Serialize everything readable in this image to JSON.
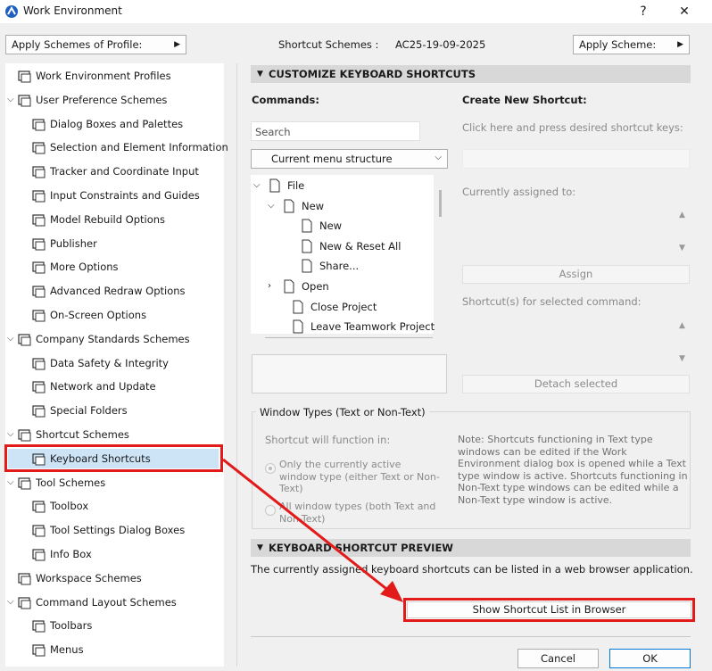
{
  "window": {
    "title": "Work Environment",
    "help_label": "?",
    "close_label": "✕"
  },
  "toolbar": {
    "apply_profile_label": "Apply Schemes of Profile:",
    "shortcut_schemes_label": "Shortcut Schemes :",
    "shortcut_schemes_value": "AC25-19-09-2025",
    "apply_scheme_label": "Apply Scheme:"
  },
  "sidebar": {
    "items": [
      {
        "label": "Work Environment Profiles",
        "icon": "profiles-icon"
      },
      {
        "label": "User Preference Schemes",
        "icon": "user-scheme-icon"
      },
      {
        "label": "Dialog Boxes and Palettes",
        "icon": "dialog-icon"
      },
      {
        "label": "Selection and Element Information",
        "icon": "selection-icon"
      },
      {
        "label": "Tracker and Coordinate Input",
        "icon": "xyz-icon"
      },
      {
        "label": "Input Constraints and Guides",
        "icon": "cursor-icon"
      },
      {
        "label": "Model Rebuild Options",
        "icon": "rebuild-icon"
      },
      {
        "label": "Publisher",
        "icon": "publisher-icon"
      },
      {
        "label": "More Options",
        "icon": "sliders-icon"
      },
      {
        "label": "Advanced Redraw Options",
        "icon": "redraw-icon"
      },
      {
        "label": "On-Screen Options",
        "icon": "screen-icon"
      },
      {
        "label": "Company Standards Schemes",
        "icon": "company-icon"
      },
      {
        "label": "Data Safety & Integrity",
        "icon": "safety-icon"
      },
      {
        "label": "Network and Update",
        "icon": "globe-icon"
      },
      {
        "label": "Special Folders",
        "icon": "folder-icon"
      },
      {
        "label": "Shortcut Schemes",
        "icon": "shortcut-scheme-icon"
      },
      {
        "label": "Keyboard Shortcuts",
        "icon": "shortcut-arrow-icon"
      },
      {
        "label": "Tool Schemes",
        "icon": "tool-scheme-icon"
      },
      {
        "label": "Toolbox",
        "icon": "toolbox-icon"
      },
      {
        "label": "Tool Settings Dialog Boxes",
        "icon": "tool-settings-icon"
      },
      {
        "label": "Info Box",
        "icon": "infobox-icon"
      },
      {
        "label": "Workspace Schemes",
        "icon": "workspace-icon"
      },
      {
        "label": "Command Layout Schemes",
        "icon": "command-layout-icon"
      },
      {
        "label": "Toolbars",
        "icon": "toolbars-icon"
      },
      {
        "label": "Menus",
        "icon": "menus-icon"
      }
    ]
  },
  "customize": {
    "header": "CUSTOMIZE KEYBOARD SHORTCUTS",
    "commands_label": "Commands:",
    "search_placeholder": "Search",
    "structure_value": "Current menu structure",
    "commands": [
      {
        "label": "File"
      },
      {
        "label": "New"
      },
      {
        "label": "New"
      },
      {
        "label": "New & Reset All"
      },
      {
        "label": "Share..."
      },
      {
        "label": "Open"
      },
      {
        "label": "Close Project"
      },
      {
        "label": "Leave Teamwork Project"
      }
    ],
    "create_label": "Create New Shortcut:",
    "press_keys_label": "Click here and press desired shortcut keys:",
    "currently_assigned_label": "Currently assigned to:",
    "assign_label": "Assign",
    "shortcuts_for_label": "Shortcut(s) for selected command:",
    "detach_label": "Detach selected"
  },
  "window_types": {
    "legend": "Window Types (Text or Non-Text)",
    "function_in_label": "Shortcut will function in:",
    "option_active": "Only the currently active window type (either Text or Non-Text)",
    "option_all": "All window types (both Text and Non-Text)",
    "note": "Note: Shortcuts functioning in Text type windows can be edited if the Work Environment dialog box is opened while a Text type window is active. Shortcuts functioning in Non-Text type windows can be edited while a Non-Text type window is active."
  },
  "preview": {
    "header": "KEYBOARD SHORTCUT PREVIEW",
    "description": "The currently assigned keyboard shortcuts can be listed in a web browser application.",
    "show_list_label": "Show Shortcut List in Browser"
  },
  "footer": {
    "cancel_label": "Cancel",
    "ok_label": "OK"
  },
  "colors": {
    "highlight": "#e31a1a",
    "selection": "#cde4f7",
    "section_header": "#d8d8d8"
  }
}
